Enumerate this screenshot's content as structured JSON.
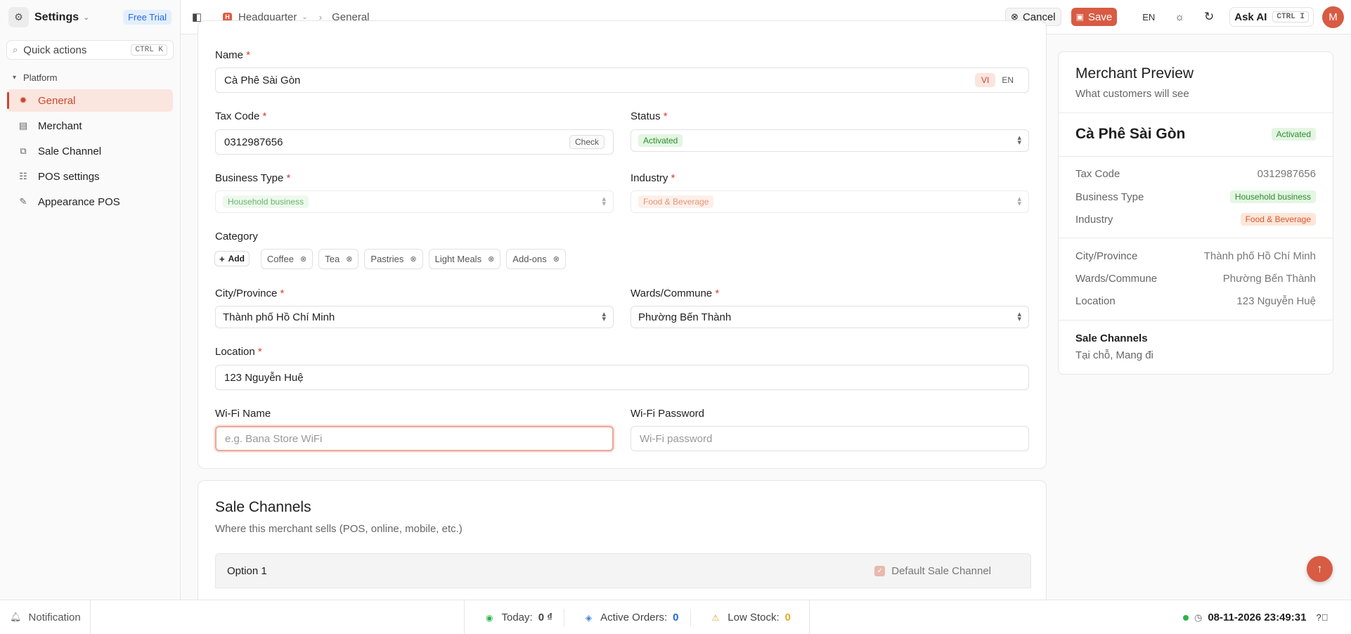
{
  "app": {
    "title": "Settings",
    "plan_badge": "Free Trial"
  },
  "quick_actions": {
    "label": "Quick actions",
    "shortcut": "CTRL K"
  },
  "sidebar": {
    "group_label": "Platform",
    "items": [
      {
        "label": "General",
        "icon": "sun-icon",
        "active": true
      },
      {
        "label": "Merchant",
        "icon": "store-icon"
      },
      {
        "label": "Sale Channel",
        "icon": "channel-icon"
      },
      {
        "label": "POS settings",
        "icon": "sliders-icon"
      },
      {
        "label": "Appearance POS",
        "icon": "palette-icon"
      }
    ]
  },
  "breadcrumb": {
    "root_badge": "H",
    "root": "Headquarter",
    "current": "General"
  },
  "toolbar": {
    "cancel": "Cancel",
    "save": "Save",
    "language": "EN",
    "ask_ai": "Ask AI",
    "ask_ai_shortcut": "CTRL I",
    "avatar_initial": "M"
  },
  "form": {
    "name": {
      "label": "Name",
      "value": "Cà Phê Sài Gòn",
      "lang_options": [
        "VI",
        "EN"
      ],
      "lang_selected": "VI"
    },
    "tax_code": {
      "label": "Tax Code",
      "value": "0312987656",
      "action": "Check"
    },
    "status": {
      "label": "Status",
      "value": "Activated"
    },
    "business_type": {
      "label": "Business Type",
      "value": "Household business"
    },
    "industry": {
      "label": "Industry",
      "value": "Food & Beverage"
    },
    "category": {
      "label": "Category",
      "add_label": "Add",
      "chips": [
        "Coffee",
        "Tea",
        "Pastries",
        "Light Meals",
        "Add-ons"
      ]
    },
    "city": {
      "label": "City/Province",
      "value": "Thành phố Hồ Chí Minh"
    },
    "ward": {
      "label": "Wards/Commune",
      "value": "Phường Bến Thành"
    },
    "location": {
      "label": "Location",
      "value": "123 Nguyễn Huệ"
    },
    "wifi_name": {
      "label": "Wi-Fi Name",
      "placeholder": "e.g. Bana Store WiFi"
    },
    "wifi_password": {
      "label": "Wi-Fi Password",
      "placeholder": "Wi-Fi password"
    },
    "required_mark": "*"
  },
  "sale_channels": {
    "title": "Sale Channels",
    "subtitle": "Where this merchant sells (POS, online, mobile, etc.)",
    "option_label": "Option 1",
    "default_label": "Default Sale Channel"
  },
  "preview": {
    "title": "Merchant Preview",
    "subtitle": "What customers will see",
    "name": "Cà Phê Sài Gòn",
    "status": "Activated",
    "rows": [
      {
        "key": "Tax Code",
        "value": "0312987656"
      },
      {
        "key": "Business Type",
        "value": "Household business"
      },
      {
        "key": "Industry",
        "value": "Food & Beverage"
      },
      {
        "key": "City/Province",
        "value": "Thành phố Hồ Chí Minh"
      },
      {
        "key": "Wards/Commune",
        "value": "Phường Bến Thành"
      },
      {
        "key": "Location",
        "value": "123 Nguyễn Huệ"
      }
    ],
    "channels_title": "Sale Channels",
    "channels_value": "Tại chỗ, Mang đi"
  },
  "statusbar": {
    "notification": "Notification",
    "today_label": "Today:",
    "today_value": "0 ₫",
    "orders_label": "Active Orders:",
    "orders_value": "0",
    "low_stock_label": "Low Stock:",
    "low_stock_value": "0",
    "datetime": "08-11-2026 23:49:31"
  },
  "colors": {
    "accent": "#d85b43",
    "active_bg": "#fbe5df",
    "success": "#2f8a2f",
    "info": "#2568d8"
  }
}
